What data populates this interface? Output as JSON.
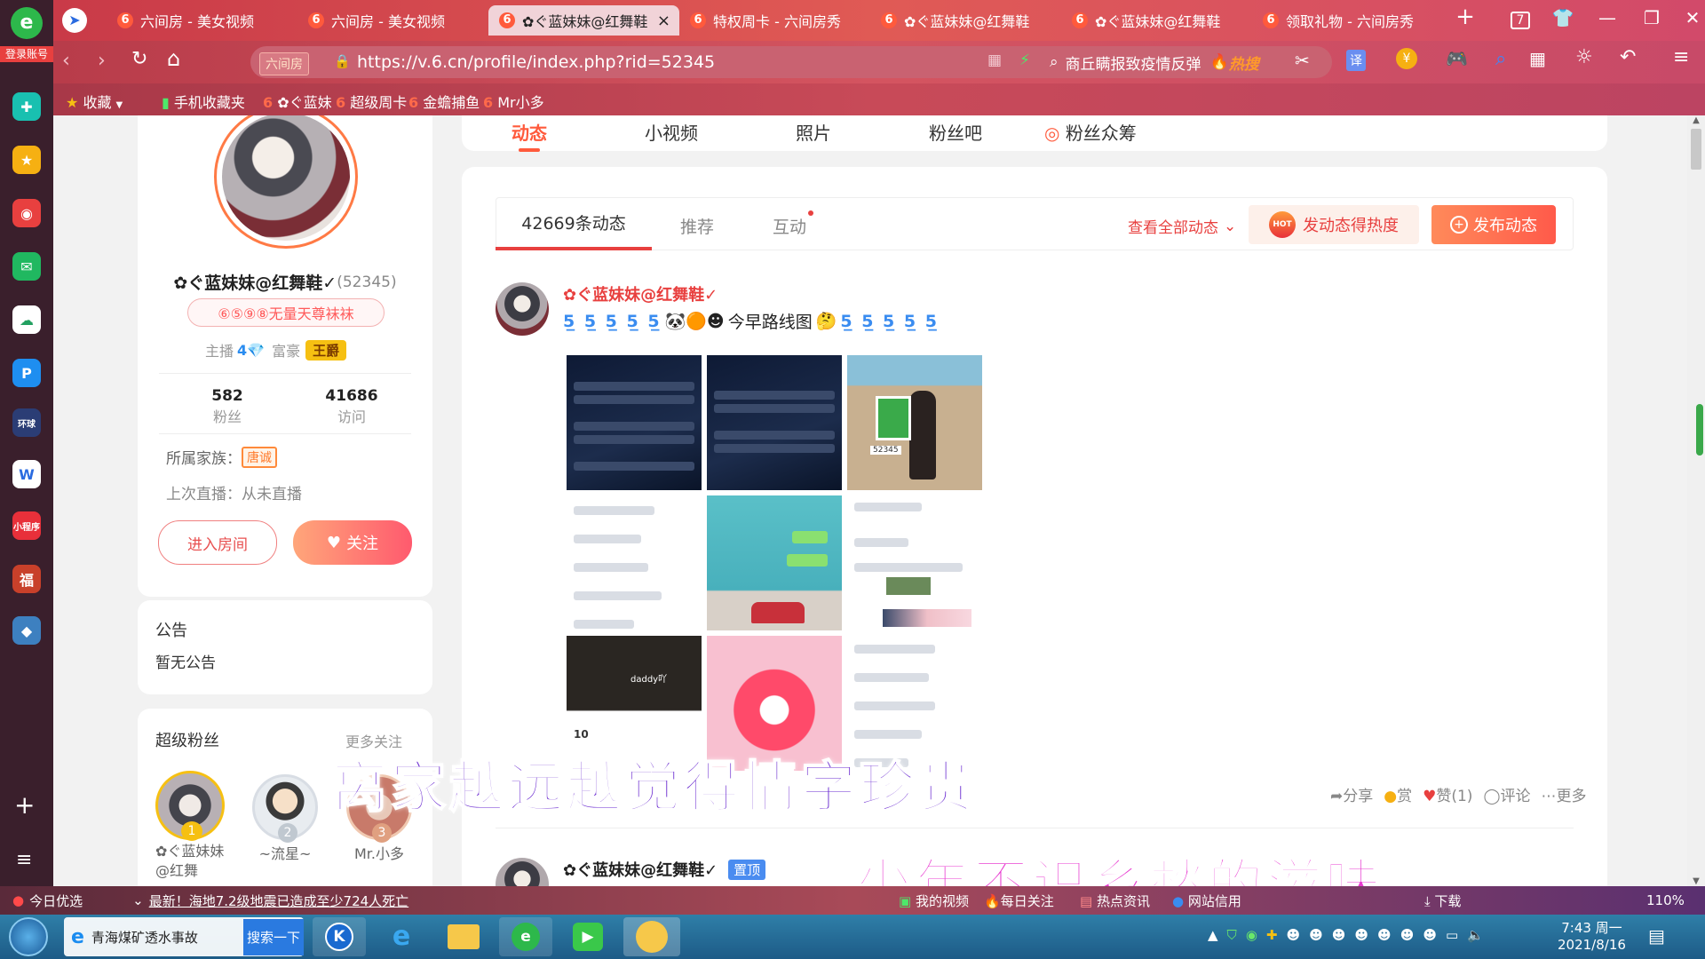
{
  "browser": {
    "logo_label": "登录账号",
    "tabs": [
      {
        "title": "六间房 - 美女视频"
      },
      {
        "title": "六间房 - 美女视频"
      },
      {
        "title": "✿ぐ蓝妹妹@红舞鞋"
      },
      {
        "title": "特权周卡 - 六间房秀"
      },
      {
        "title": "✿ぐ蓝妹妹@红舞鞋"
      },
      {
        "title": "✿ぐ蓝妹妹@红舞鞋"
      },
      {
        "title": "领取礼物 - 六间房秀"
      }
    ],
    "tab_counter": "7",
    "url": "https://v.6.cn/profile/index.php?rid=52345",
    "url_site_badge": "六间房",
    "search_text": "商丘瞒报致疫情反弹",
    "search_hot": "热搜",
    "bookmarks": [
      "收藏",
      "手机收藏夹",
      "✿ぐ蓝妹",
      "超级周卡",
      "金蟾捕鱼",
      "Mr小多"
    ]
  },
  "profile": {
    "name": "✿ぐ蓝妹妹@红舞鞋✓",
    "rid": "(52345)",
    "badge": "⑥⑤⑨⑧无量天尊袜袜",
    "host_label": "主播",
    "rich_label": "富豪",
    "rich_rank": "王爵",
    "fans_count": "582",
    "fans_label": "粉丝",
    "visits_count": "41686",
    "visits_label": "访问",
    "family_label": "所属家族：",
    "family_name": "唐诚",
    "last_live": "上次直播：从未直播",
    "enter_room": "进入房间",
    "follow": "关注"
  },
  "notice": {
    "title": "公告",
    "text": "暂无公告"
  },
  "super_fans": {
    "title": "超级粉丝",
    "more": "更多关注",
    "fans": [
      {
        "rank": "1",
        "name": "✿ぐ蓝妹妹@红舞"
      },
      {
        "rank": "2",
        "name": "~流星~"
      },
      {
        "rank": "3",
        "name": "Mr.小多"
      }
    ]
  },
  "nav_tabs": [
    "动态",
    "小视频",
    "照片",
    "粉丝吧",
    "粉丝众筹"
  ],
  "feed_tabs": {
    "count_label": "42669条动态",
    "recommend": "推荐",
    "interact": "互动",
    "view_all": "查看全部动态",
    "hot_btn": "发动态得热度",
    "hot_badge": "HOT",
    "publish_btn": "发布动态"
  },
  "post": {
    "author": "✿ぐ蓝妹妹@红舞鞋✓",
    "text": "今早路线图",
    "share": "分享",
    "reward": "赏",
    "like": "赞(1)",
    "comment": "评论",
    "more": "更多",
    "img2_tag": "52345",
    "img7_label": "10",
    "img8_label": "daddy吖"
  },
  "post2": {
    "author": "✿ぐ蓝妹妹@红舞鞋✓",
    "pin": "置顶"
  },
  "subtitles": {
    "line1": "离家越远越觉得情字珍贵",
    "line2": "少年不识乡愁的滋味"
  },
  "statusbar": {
    "left": "今日优选",
    "news": "最新！海地7.2级地震已造成至少724人死亡",
    "items": [
      "我的视频",
      "每日关注",
      "热点资讯",
      "网站信用"
    ],
    "download": "下载",
    "zoom": "110%"
  },
  "taskbar": {
    "app_title": "青海煤矿透水事故",
    "search_btn": "搜索一下",
    "time": "7:43 周一",
    "date": "2021/8/16"
  },
  "colors": {
    "accent": "#ff5a3c",
    "brand_red": "#e8403f",
    "orange": "#ff7a45"
  }
}
